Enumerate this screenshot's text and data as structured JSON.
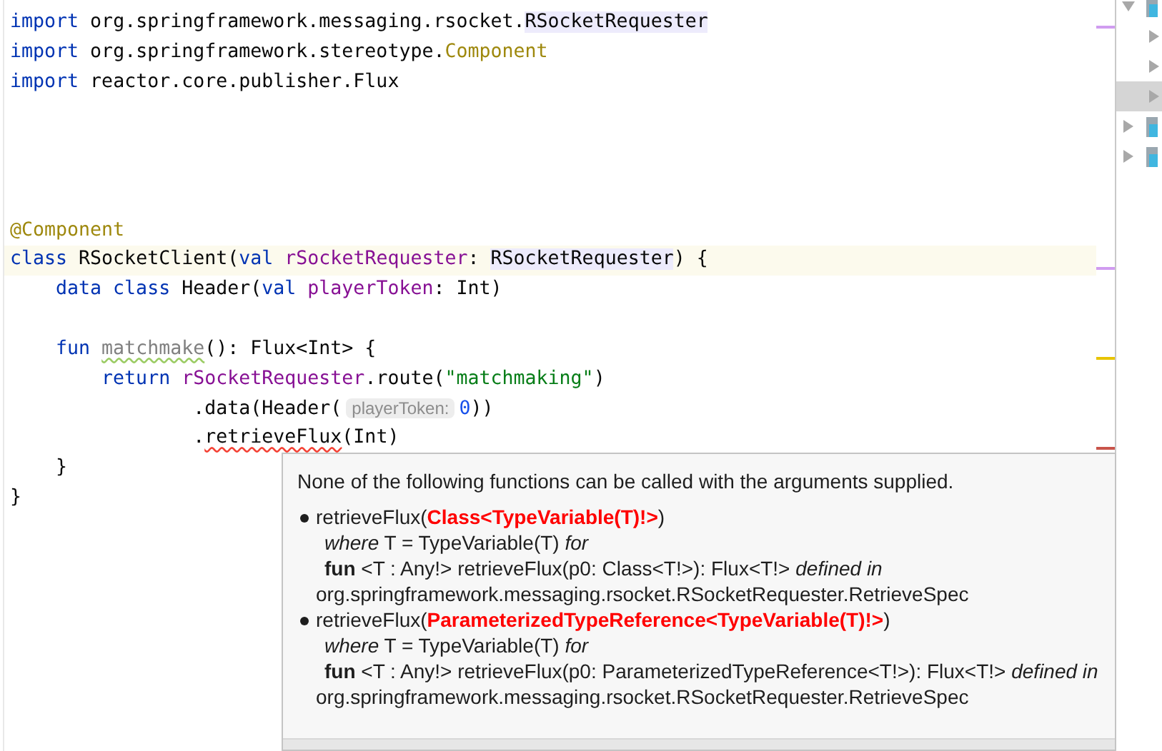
{
  "editor": {
    "lines": [
      {
        "current": false,
        "tokens": [
          {
            "text": "import",
            "kind": "keyword"
          },
          {
            "text": " org.springframework.messaging.rsocket.",
            "kind": "plain"
          },
          {
            "text": "RSocketRequester",
            "kind": "plain",
            "highlighted": true
          }
        ]
      },
      {
        "current": false,
        "tokens": [
          {
            "text": "import",
            "kind": "keyword"
          },
          {
            "text": " org.springframework.stereotype.",
            "kind": "plain"
          },
          {
            "text": "Component",
            "kind": "annotation"
          }
        ]
      },
      {
        "current": false,
        "tokens": [
          {
            "text": "import",
            "kind": "keyword"
          },
          {
            "text": " reactor.core.publisher.Flux",
            "kind": "plain"
          }
        ]
      },
      {
        "current": false
      },
      {
        "current": false
      },
      {
        "current": false
      },
      {
        "current": false
      },
      {
        "current": false,
        "tokens": [
          {
            "text": "@Component",
            "kind": "annotation"
          }
        ]
      },
      {
        "current": true,
        "tokens": [
          {
            "text": "class",
            "kind": "keyword"
          },
          {
            "text": " RSocketClient(",
            "kind": "plain"
          },
          {
            "text": "val",
            "kind": "keyword"
          },
          {
            "text": " rSocketRequester",
            "kind": "param"
          },
          {
            "text": ": ",
            "kind": "plain"
          },
          {
            "text": "RSocketRequester",
            "kind": "plain",
            "highlighted": true
          },
          {
            "text": ") {",
            "kind": "plain"
          }
        ]
      },
      {
        "current": false,
        "tokens": [
          {
            "text": "    data class",
            "kind": "keyword"
          },
          {
            "text": " Header(",
            "kind": "plain"
          },
          {
            "text": "val",
            "kind": "keyword"
          },
          {
            "text": " playerToken",
            "kind": "param"
          },
          {
            "text": ": Int)",
            "kind": "plain"
          }
        ]
      },
      {
        "current": false
      },
      {
        "current": false,
        "tokens": [
          {
            "text": "    fun ",
            "kind": "keyword"
          },
          {
            "text": "matchmake",
            "kind": "unused"
          },
          {
            "text": "(): Flux<Int> {",
            "kind": "plain"
          }
        ]
      },
      {
        "current": false,
        "tokens": [
          {
            "text": "        return ",
            "kind": "keyword"
          },
          {
            "text": "rSocketRequester",
            "kind": "param"
          },
          {
            "text": ".route(",
            "kind": "plain"
          },
          {
            "text": "\"matchmaking\"",
            "kind": "string"
          },
          {
            "text": ")",
            "kind": "plain"
          }
        ]
      },
      {
        "current": false,
        "tokens": [
          {
            "text": "                .data(Header(",
            "kind": "plain"
          },
          {
            "text": "playerToken:",
            "kind": "hint"
          },
          {
            "text": "0",
            "kind": "number"
          },
          {
            "text": "))",
            "kind": "plain"
          }
        ]
      },
      {
        "current": false,
        "tokens": [
          {
            "text": "                .",
            "kind": "plain"
          },
          {
            "text": "retrieveFlux",
            "kind": "error"
          },
          {
            "text": "(Int)",
            "kind": "plain"
          }
        ]
      },
      {
        "current": false,
        "tokens": [
          {
            "text": "    }",
            "kind": "plain"
          }
        ]
      },
      {
        "current": false,
        "tokens": [
          {
            "text": "}",
            "kind": "plain"
          }
        ]
      }
    ]
  },
  "project_tree": {
    "items": [
      {
        "expanded": true,
        "selected": false,
        "children": [
          {
            "expanded": false,
            "selected": false
          },
          {
            "expanded": false,
            "selected": false
          },
          {
            "expanded": false,
            "selected": true
          }
        ]
      },
      {
        "expanded": false,
        "selected": false
      },
      {
        "expanded": false,
        "selected": false
      }
    ]
  },
  "error_popup": {
    "title": "None of the following functions can be called with the arguments supplied.",
    "candidates": [
      {
        "call": "retrieveFlux(",
        "mismatch": "Class<TypeVariable(T)!>",
        "close": ")",
        "where": "*where* T = TypeVariable(T) *for*",
        "signature": "**fun** <T : Any!> retrieveFlux(p0: Class<T!>): Flux<T!> *defined in* org.springframework.messaging.rsocket.RSocketRequester.RetrieveSpec"
      },
      {
        "call": "retrieveFlux(",
        "mismatch": "ParameterizedTypeReference<TypeVariable(T)!>",
        "close": ")",
        "where": "*where* T = TypeVariable(T) *for*",
        "signature": "**fun** <T : Any!> retrieveFlux(p0: ParameterizedTypeReference<T!>): Flux<T!> *defined in* org.springframework.messaging.rsocket.RSocketRequester.RetrieveSpec"
      }
    ]
  }
}
